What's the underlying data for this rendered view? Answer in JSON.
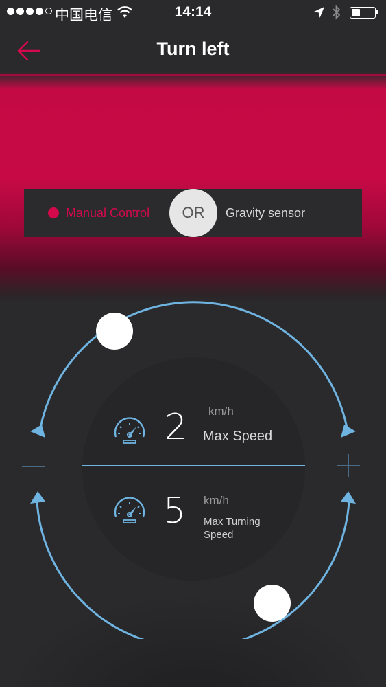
{
  "status_bar": {
    "carrier": "中国电信",
    "time": "14:14"
  },
  "nav": {
    "title": "Turn left",
    "back_icon": "arrow-left-icon"
  },
  "mode_selector": {
    "manual_label": "Manual Control",
    "or_label": "OR",
    "gravity_label": "Gravity sensor",
    "selected": "Manual Control"
  },
  "max_speed": {
    "value": "2",
    "unit": "km/h",
    "label": "Max Speed",
    "icon": "speedometer-icon"
  },
  "max_turning_speed": {
    "value": "5",
    "unit": "km/h",
    "label": "Max Turning Speed",
    "icon": "speedometer-icon"
  },
  "colors": {
    "accent": "#d3094b",
    "ring": "#6fb3e0",
    "background": "#2a2a2c"
  }
}
